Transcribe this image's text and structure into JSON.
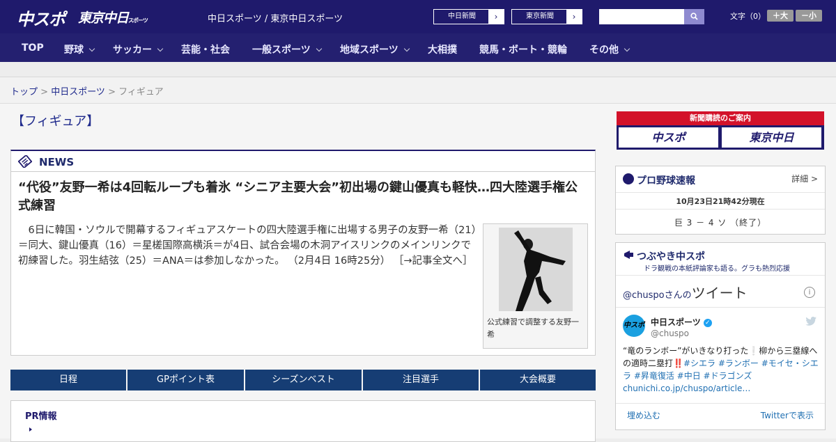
{
  "header": {
    "logo_main": "中スポ",
    "logo_tokyo": "東京中日",
    "logo_tokyo_small": "スポーツ",
    "site_names": "中日スポーツ / 東京中日スポーツ",
    "chunichi_btn": "中日新聞",
    "tokyo_btn": "東京新聞",
    "arrow": "›",
    "search_placeholder": "",
    "font_label": "文字（0）",
    "font_bigger": "＋大",
    "font_smaller": "－小"
  },
  "gnav": {
    "items": [
      {
        "label": "TOP",
        "has_menu": false
      },
      {
        "label": "野球",
        "has_menu": true
      },
      {
        "label": "サッカー",
        "has_menu": true
      },
      {
        "label": "芸能・社会",
        "has_menu": false
      },
      {
        "label": "一般スポーツ",
        "has_menu": true
      },
      {
        "label": "地域スポーツ",
        "has_menu": true
      },
      {
        "label": "大相撲",
        "has_menu": false
      },
      {
        "label": "競馬・ボート・競輪",
        "has_menu": false
      },
      {
        "label": "その他",
        "has_menu": true
      }
    ]
  },
  "breadcrumb": {
    "top": "トップ",
    "sep": " > ",
    "section": "中日スポーツ",
    "current": "フィギュア"
  },
  "page": {
    "title": "【フィギュア】"
  },
  "news": {
    "label": "NEWS",
    "headline": "“代役”友野一希は4回転ループも着氷 “シニア主要大会”初出場の鍵山優真も軽快…四大陸選手権公式練習",
    "body": "6日に韓国・ソウルで開幕するフィギュアスケートの四大陸選手権に出場する男子の友野一希（21）＝同大、鍵山優真（16）＝星槎国際高横浜＝が4日、試合会場の木洞アイスリンクのメインリンクで初練習した。羽生結弦（25）＝ANA＝は参加しなかった。",
    "timestamp": "（2月4日 16時25分）",
    "more": "［→記事全文へ］",
    "photo_caption": "公式練習で調整する友野一希"
  },
  "tabs": [
    "日程",
    "GPポイント表",
    "シーズンベスト",
    "注目選手",
    "大会概要"
  ],
  "pr": {
    "title": "PR情報"
  },
  "sidebar": {
    "subscribe_title": "新聞購読のご案内",
    "subscribe_chuspo": "中スポ",
    "subscribe_tokyo": "東京中日",
    "baseball": {
      "title": "プロ野球速報",
      "detail": "詳細 >",
      "time": "10月23日21時42分現在",
      "score": "巨 3 － 4 ソ （終了）"
    },
    "twitter": {
      "title": "つぶやき中スポ",
      "subtitle": "ドラ観戦の本紙評論家も語る。グラも熱烈応援",
      "handle_prefix": "@chuspo",
      "handle_suffix": "さんの",
      "tweets_label": "ツイート",
      "info": "i",
      "avatar_text": "中スポ",
      "name": "中日スポーツ",
      "verified": "✓",
      "handle": "@chuspo",
      "text_main": "“竜のランボー”がいきなり打った❕柳から三塁線への適時二塁打‼️",
      "hashtags": "#シエラ #ランボー #モイセ・シエラ #昇竜復活 #中日 #ドラゴンズ",
      "link": "chunichi.co.jp/chuspo/article…",
      "embed": "埋め込む",
      "view": "Twitterで表示"
    }
  },
  "colors": {
    "header_bg": "#1f1a6c",
    "nav_bg": "#242070",
    "tab_bg": "#163d74",
    "subscribe_red": "#d3122a",
    "link": "#1f2a8c"
  }
}
